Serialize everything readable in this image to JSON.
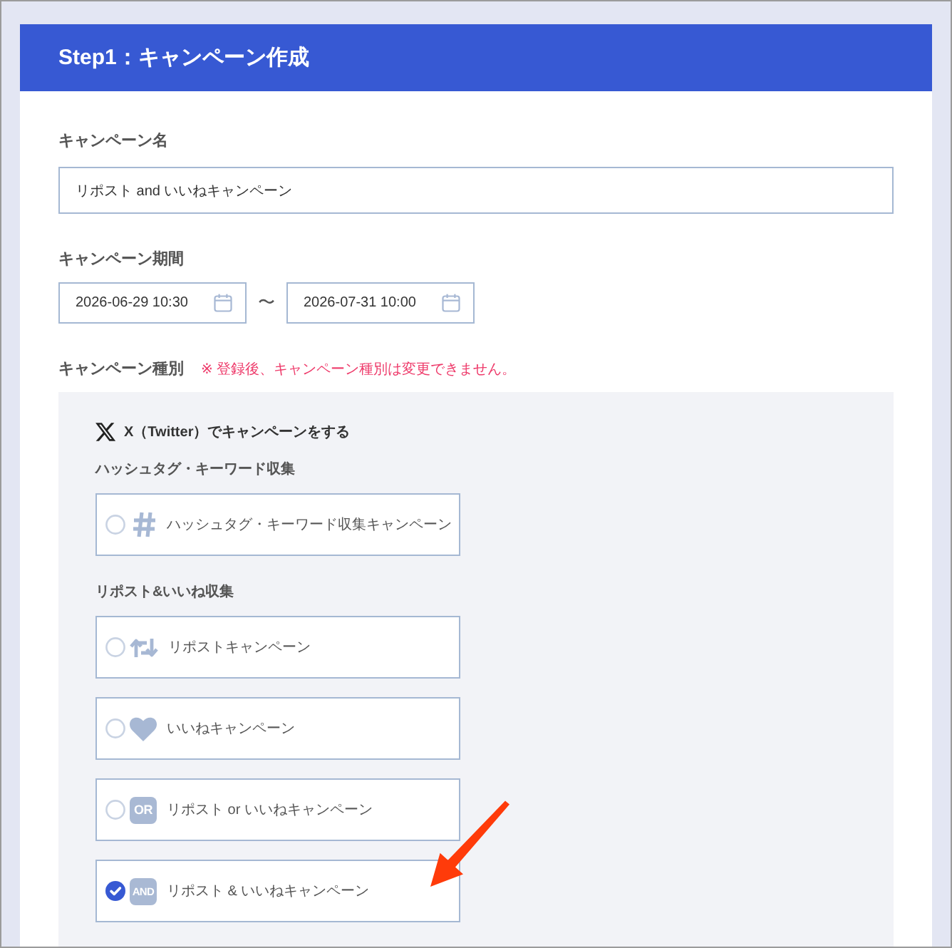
{
  "header": {
    "title": "Step1：キャンペーン作成"
  },
  "name_field": {
    "label": "キャンペーン名",
    "value": "リポスト and いいねキャンペーン"
  },
  "period": {
    "label": "キャンペーン期間",
    "start": "2026-06-29 10:30",
    "separator": "〜",
    "end": "2026-07-31 10:00"
  },
  "campaign_type": {
    "label": "キャンペーン種別",
    "note": "※ 登録後、キャンペーン種別は変更できません。",
    "platform": "X（Twitter）でキャンペーンをする",
    "groups": [
      {
        "heading": "ハッシュタグ・キーワード収集",
        "options": [
          {
            "kind": "hashtag",
            "label": "ハッシュタグ・キーワード収集キャンペーン",
            "selected": false
          }
        ]
      },
      {
        "heading": "リポスト&いいね収集",
        "options": [
          {
            "kind": "repost",
            "label": "リポストキャンペーン",
            "selected": false
          },
          {
            "kind": "like",
            "label": "いいねキャンペーン",
            "selected": false
          },
          {
            "kind": "badge",
            "badge": "OR",
            "label": "リポスト or いいねキャンペーン",
            "selected": false
          },
          {
            "kind": "badge",
            "badge": "AND",
            "label": "リポスト & いいねキャンペーン",
            "selected": true
          }
        ]
      }
    ]
  }
}
